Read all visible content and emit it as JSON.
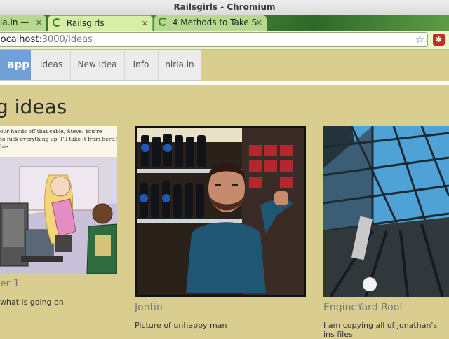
{
  "window": {
    "title": "Railsgirls - Chromium"
  },
  "tabs": [
    {
      "label": "ia.in —"
    },
    {
      "label": "Railsgirls"
    },
    {
      "label": "4 Methods to Take S"
    }
  ],
  "omnibox": {
    "host": "localhost",
    "path": ":3000/ideas"
  },
  "extension": {
    "glyph": "✱"
  },
  "nav": {
    "brand": "app",
    "items": [
      "Ideas",
      "New Idea",
      "Info",
      "niria.in"
    ]
  },
  "page": {
    "heading": "g ideas"
  },
  "cards": [
    {
      "title": "er 1",
      "description": "what is going on",
      "comic_text": "our hands off that cable, Steve. You're to fuck everything up. I'll take it from here,\" bie."
    },
    {
      "title": "Jontin",
      "description": "Picture of unhappy man"
    },
    {
      "title": "EngineYard Roof",
      "description": "I am copying all of jonathan's ins files"
    }
  ]
}
